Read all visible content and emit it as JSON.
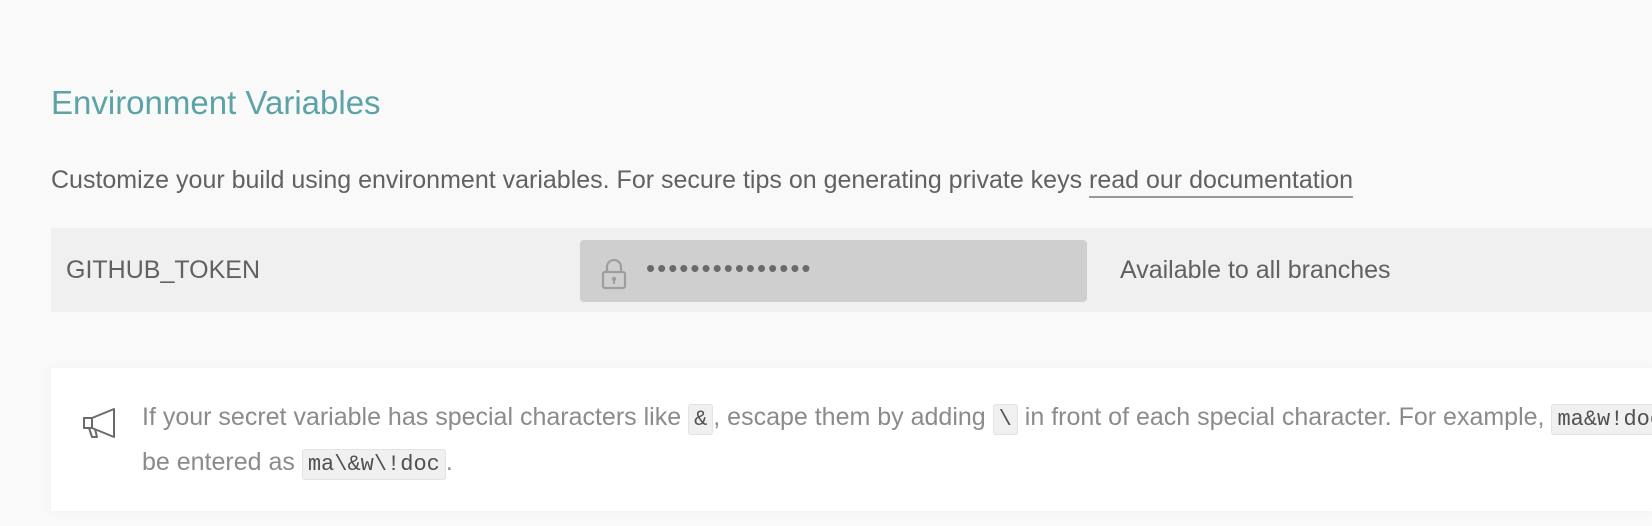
{
  "section": {
    "title": "Environment Variables",
    "description_text": "Customize your build using environment variables. For secure tips on generating private keys ",
    "doc_link_label": "read our documentation"
  },
  "env_vars": [
    {
      "name": "GITHUB_TOKEN",
      "value_masked": "•••••••••••••••",
      "value_icon": "lock-icon",
      "branch": "Available to all branches"
    }
  ],
  "notice": {
    "icon": "megaphone-icon",
    "text_1": "If your secret variable has special characters like ",
    "code_1": "&",
    "text_2": ", escape them by adding ",
    "code_2": "\\",
    "text_3": " in front of each special character. For example, ",
    "code_3": "ma&w!doc",
    "text_4": " would be entered as ",
    "code_4": "ma\\&w\\!doc",
    "text_5": "."
  },
  "colors": {
    "title_accent": "#5ba3a7",
    "text": "#606162",
    "muted_text": "#8a8b8c",
    "row_bg": "#f0f0f0",
    "value_bg": "#cfcfcf"
  }
}
